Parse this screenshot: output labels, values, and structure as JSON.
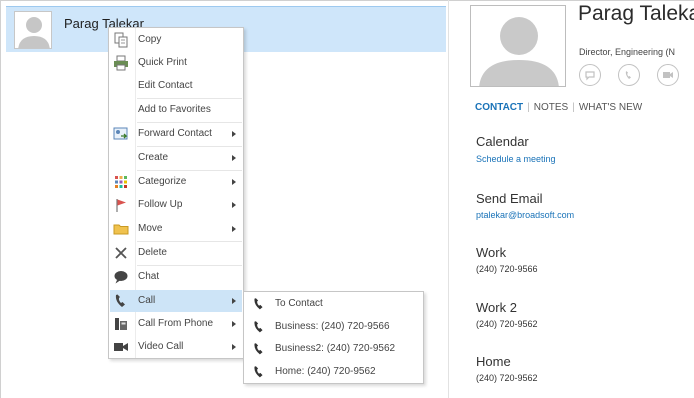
{
  "contact_list": {
    "selected_contact_name": "Parag Talekar"
  },
  "contact_card": {
    "name": "Parag Taleka",
    "title": "Director, Engineering (N",
    "action_icons": [
      "im-icon",
      "phone-icon",
      "video-icon"
    ],
    "tabs": [
      {
        "label": "CONTACT",
        "active": true
      },
      {
        "label": "NOTES",
        "active": false
      },
      {
        "label": "WHAT'S NEW",
        "active": false
      }
    ],
    "details": [
      {
        "label": "Calendar",
        "value": "Schedule a meeting",
        "is_link": true
      },
      {
        "label": "Send Email",
        "value": "ptalekar@broadsoft.com",
        "is_link": true
      },
      {
        "label": "Work",
        "value": "(240) 720-9566",
        "is_link": false
      },
      {
        "label": "Work 2",
        "value": "(240) 720-9562",
        "is_link": false
      },
      {
        "label": "Home",
        "value": "(240) 720-9562",
        "is_link": false
      }
    ]
  },
  "context_menu": {
    "items": [
      {
        "label": "Copy",
        "icon": "copy-icon",
        "has_submenu": false
      },
      {
        "label": "Quick Print",
        "icon": "printer-icon",
        "has_submenu": false
      },
      {
        "label": "Edit Contact",
        "icon": "",
        "has_submenu": false
      },
      {
        "label": "Add to Favorites",
        "icon": "",
        "has_submenu": false
      },
      {
        "label": "Forward Contact",
        "icon": "forward-contact-icon",
        "has_submenu": true
      },
      {
        "label": "Create",
        "icon": "",
        "has_submenu": true
      },
      {
        "label": "Categorize",
        "icon": "categorize-icon",
        "has_submenu": true
      },
      {
        "label": "Follow Up",
        "icon": "flag-icon",
        "has_submenu": true
      },
      {
        "label": "Move",
        "icon": "folder-icon",
        "has_submenu": true
      },
      {
        "label": "Delete",
        "icon": "delete-icon",
        "has_submenu": false
      },
      {
        "label": "Chat",
        "icon": "chat-icon",
        "has_submenu": false
      },
      {
        "label": "Call",
        "icon": "phone-icon",
        "has_submenu": true,
        "highlighted": true
      },
      {
        "label": "Call From Phone",
        "icon": "desk-phone-icon",
        "has_submenu": true
      },
      {
        "label": "Video Call",
        "icon": "video-camera-icon",
        "has_submenu": true
      }
    ]
  },
  "call_submenu": {
    "items": [
      {
        "label": "To Contact",
        "icon": "phone-icon"
      },
      {
        "label": "Business: (240) 720-9566",
        "icon": "phone-icon"
      },
      {
        "label": "Business2: (240) 720-9562",
        "icon": "phone-icon"
      },
      {
        "label": "Home: (240) 720-9562",
        "icon": "phone-icon"
      }
    ]
  },
  "colors": {
    "selection_blue": "#cfe6fa",
    "link_blue": "#1a73b8",
    "menu_highlight": "#cde4f7"
  }
}
